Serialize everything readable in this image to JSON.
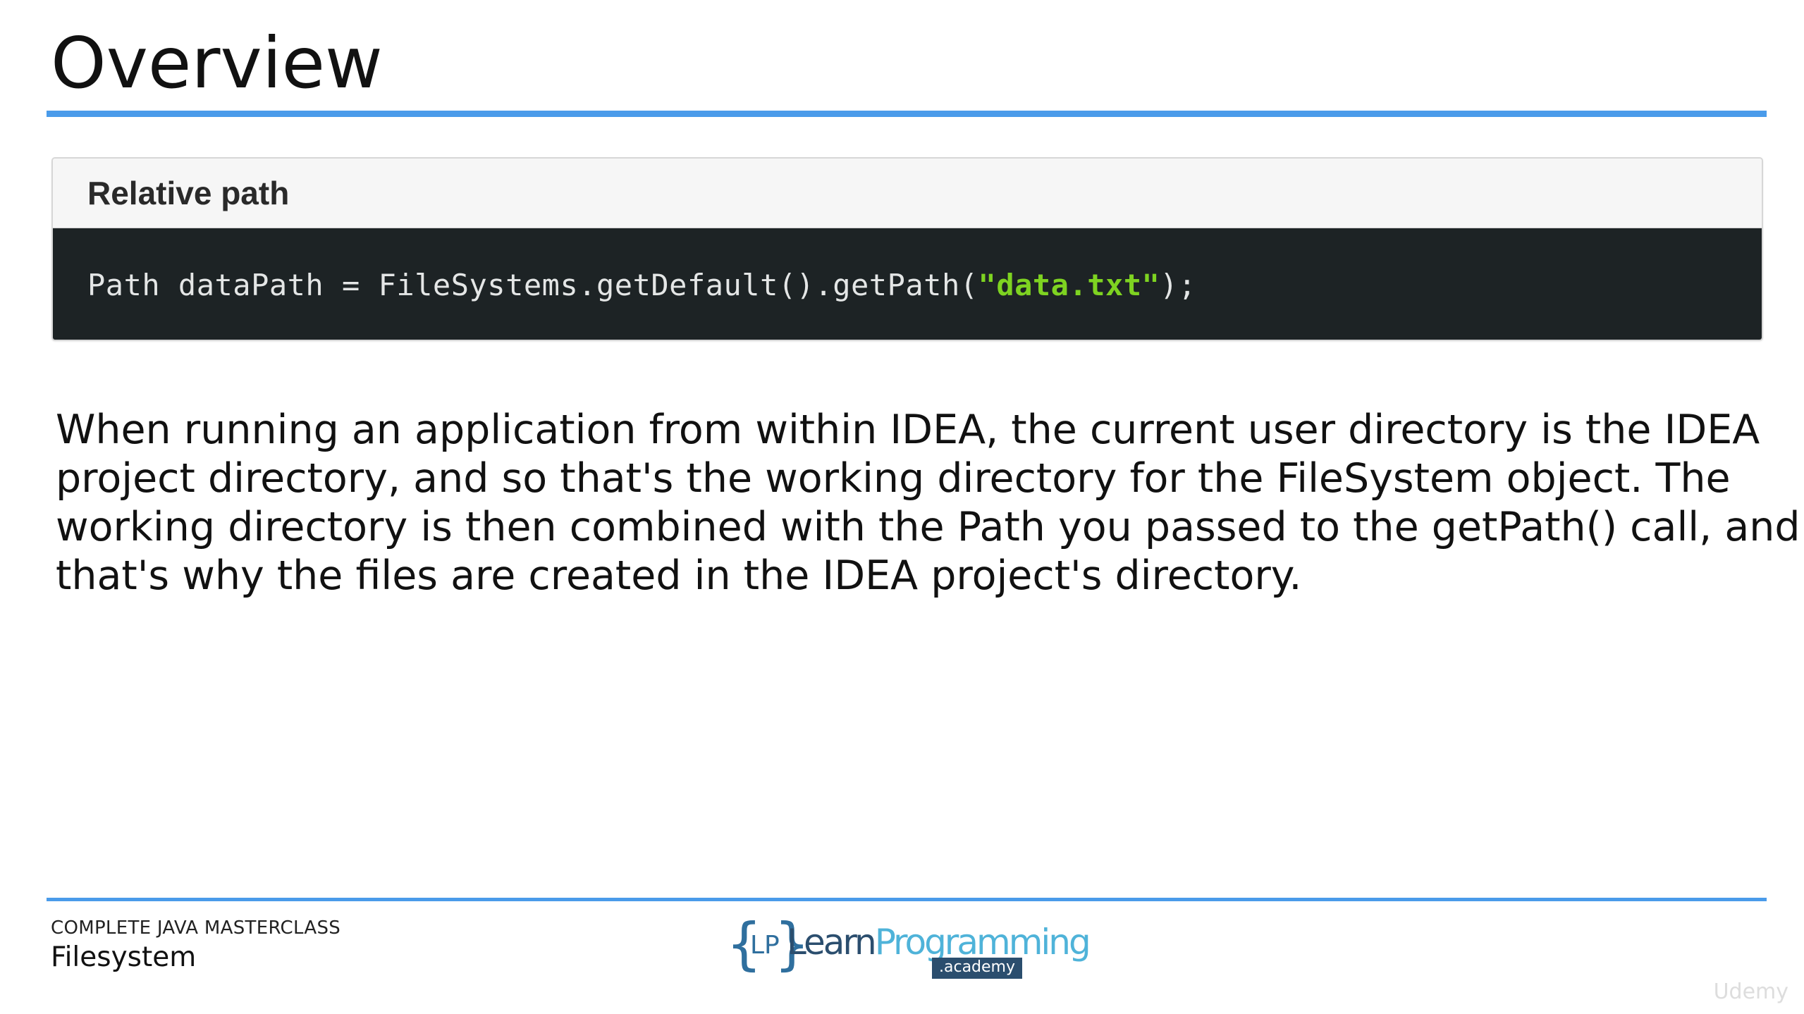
{
  "slide": {
    "title": "Overview"
  },
  "code_block": {
    "header": "Relative path",
    "code_before": "Path dataPath = FileSystems.getDefault().getPath(",
    "code_string": "\"data.txt\"",
    "code_after": ");"
  },
  "body": {
    "lines": [
      "When running an application from within IDEA, the current user directory is the IDEA",
      "project directory, and so that's the working directory for the FileSystem object. The",
      "working directory is then combined with the Path you passed to the getPath() call, and",
      "that's why the files are created in the IDEA project's directory."
    ]
  },
  "footer": {
    "course": "COMPLETE JAVA MASTERCLASS",
    "section": "Filesystem",
    "logo": {
      "brace_open": "{",
      "monogram": "LP",
      "brace_close": "}",
      "word_learn": "Learn",
      "word_programming": "Programming",
      "badge": ".academy"
    },
    "watermark": "Udemy"
  },
  "colors": {
    "accent_rule": "#4a9bea",
    "code_background": "#1d2325",
    "code_text": "#e4e6e6",
    "code_string": "#7ed321",
    "header_background": "#f6f6f6",
    "logo_dark": "#2b4e6e",
    "logo_light": "#4fb3d9"
  }
}
